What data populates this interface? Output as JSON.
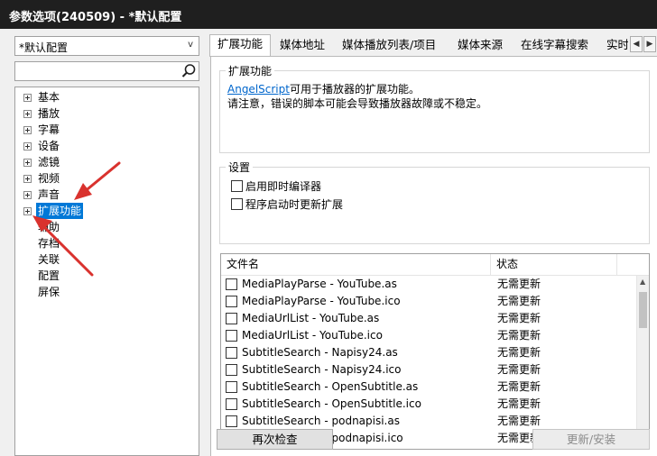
{
  "window": {
    "title": "参数选项(240509) - *默认配置"
  },
  "left": {
    "profile_value": "*默认配置",
    "search": {
      "value": "",
      "placeholder": ""
    },
    "tree": [
      {
        "label": "基本",
        "expandable": true
      },
      {
        "label": "播放",
        "expandable": true
      },
      {
        "label": "字幕",
        "expandable": true
      },
      {
        "label": "设备",
        "expandable": true
      },
      {
        "label": "滤镜",
        "expandable": true
      },
      {
        "label": "视频",
        "expandable": true
      },
      {
        "label": "声音",
        "expandable": true
      },
      {
        "label": "扩展功能",
        "expandable": true,
        "selected": true
      },
      {
        "label": "辅助",
        "expandable": false
      },
      {
        "label": "存档",
        "expandable": false
      },
      {
        "label": "关联",
        "expandable": false
      },
      {
        "label": "配置",
        "expandable": false
      },
      {
        "label": "屏保",
        "expandable": false
      }
    ]
  },
  "tabs": [
    "扩展功能",
    "媒体地址",
    "媒体播放列表/项目",
    "媒体来源",
    "在线字幕搜索",
    "实时"
  ],
  "extension": {
    "group_title": "扩展功能",
    "link_text": "AngelScript",
    "desc_line1_rest": "可用于播放器的扩展功能。",
    "desc_line2": "请注意，错误的脚本可能会导致播放器故障或不稳定。"
  },
  "settings": {
    "group_title": "设置",
    "options": [
      {
        "label": "启用即时编译器",
        "checked": false
      },
      {
        "label": "程序启动时更新扩展",
        "checked": false
      }
    ]
  },
  "file_list": {
    "columns": [
      "文件名",
      "状态"
    ],
    "rows": [
      {
        "name": "MediaPlayParse - YouTube.as",
        "status": "无需更新",
        "checked": false
      },
      {
        "name": "MediaPlayParse - YouTube.ico",
        "status": "无需更新",
        "checked": false
      },
      {
        "name": "MediaUrlList - YouTube.as",
        "status": "无需更新",
        "checked": false
      },
      {
        "name": "MediaUrlList - YouTube.ico",
        "status": "无需更新",
        "checked": false
      },
      {
        "name": "SubtitleSearch - Napisy24.as",
        "status": "无需更新",
        "checked": false
      },
      {
        "name": "SubtitleSearch - Napisy24.ico",
        "status": "无需更新",
        "checked": false
      },
      {
        "name": "SubtitleSearch - OpenSubtitle.as",
        "status": "无需更新",
        "checked": false
      },
      {
        "name": "SubtitleSearch - OpenSubtitle.ico",
        "status": "无需更新",
        "checked": false
      },
      {
        "name": "SubtitleSearch - podnapisi.as",
        "status": "无需更新",
        "checked": false
      },
      {
        "name": "SubtitleSearch - podnapisi.ico",
        "status": "无需更新",
        "checked": false
      }
    ]
  },
  "buttons": {
    "recheck": "再次检查",
    "update_install": "更新/安装"
  },
  "colors": {
    "selection": "#0078d7",
    "annotation_arrow": "#d9322e",
    "titlebar": "#1f1f1f",
    "link": "#0066cc"
  }
}
